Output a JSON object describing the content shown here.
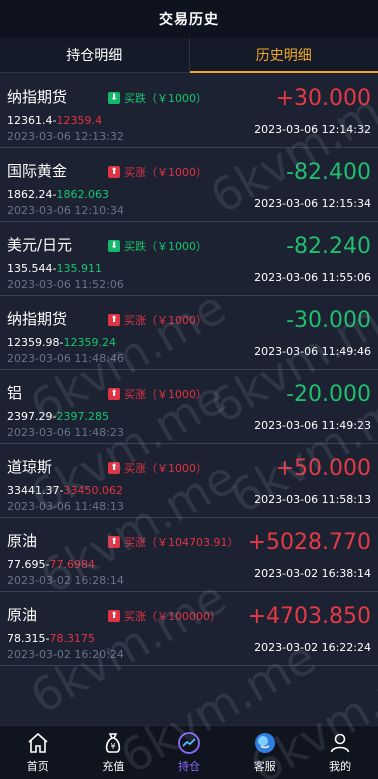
{
  "header": {
    "title": "交易历史"
  },
  "tabs": [
    {
      "label": "持仓明细",
      "active": false
    },
    {
      "label": "历史明细",
      "active": true
    }
  ],
  "records": [
    {
      "name": "纳指期货",
      "direction": "down",
      "direction_text": "买跌（￥1000）",
      "open_price": "12361.4",
      "close_price": "12359.4",
      "close_dir": "up",
      "open_time": "2023-03-06 12:13:32",
      "pnl": "+30.000",
      "pnl_sign": "pos",
      "close_time": "2023-03-06 12:14:32"
    },
    {
      "name": "国际黄金",
      "direction": "up",
      "direction_text": "买涨（￥1000）",
      "open_price": "1862.24",
      "close_price": "1862.063",
      "close_dir": "down",
      "open_time": "2023-03-06 12:10:34",
      "pnl": "-82.400",
      "pnl_sign": "neg",
      "close_time": "2023-03-06 12:15:34"
    },
    {
      "name": "美元/日元",
      "direction": "down",
      "direction_text": "买跌（￥1000）",
      "open_price": "135.544",
      "close_price": "135.911",
      "close_dir": "down",
      "open_time": "2023-03-06 11:52:06",
      "pnl": "-82.240",
      "pnl_sign": "neg",
      "close_time": "2023-03-06 11:55:06"
    },
    {
      "name": "纳指期货",
      "direction": "up",
      "direction_text": "买涨（￥1000）",
      "open_price": "12359.98",
      "close_price": "12359.24",
      "close_dir": "down",
      "open_time": "2023-03-06 11:48:46",
      "pnl": "-30.000",
      "pnl_sign": "neg",
      "close_time": "2023-03-06 11:49:46"
    },
    {
      "name": "铝",
      "direction": "up",
      "direction_text": "买涨（￥1000）",
      "open_price": "2397.29",
      "close_price": "2397.285",
      "close_dir": "down",
      "open_time": "2023-03-06 11:48:23",
      "pnl": "-20.000",
      "pnl_sign": "neg",
      "close_time": "2023-03-06 11:49:23"
    },
    {
      "name": "道琼斯",
      "direction": "up",
      "direction_text": "买涨（￥1000）",
      "open_price": "33441.37",
      "close_price": "33450.062",
      "close_dir": "up",
      "open_time": "2023-03-06 11:48:13",
      "pnl": "+50.000",
      "pnl_sign": "pos",
      "close_time": "2023-03-06 11:58:13"
    },
    {
      "name": "原油",
      "direction": "up",
      "direction_text": "买涨（￥104703.91）",
      "open_price": "77.695",
      "close_price": "77.6984",
      "close_dir": "up",
      "open_time": "2023-03-02 16:28:14",
      "pnl": "+5028.770",
      "pnl_sign": "pos",
      "close_time": "2023-03-02 16:38:14"
    },
    {
      "name": "原油",
      "direction": "up",
      "direction_text": "买涨（￥100000）",
      "open_price": "78.315",
      "close_price": "78.3175",
      "close_dir": "up",
      "open_time": "2023-03-02 16:20:24",
      "pnl": "+4703.850",
      "pnl_sign": "pos",
      "close_time": "2023-03-02 16:22:24"
    }
  ],
  "watermark": "6kvm.me",
  "nav": [
    {
      "label": "首页",
      "icon": "home-icon"
    },
    {
      "label": "充值",
      "icon": "money-bag-icon"
    },
    {
      "label": "持仓",
      "icon": "chart-icon",
      "active": true
    },
    {
      "label": "客服",
      "icon": "support-icon"
    },
    {
      "label": "我的",
      "icon": "user-icon"
    }
  ],
  "colors": {
    "up": "#e03344",
    "down": "#17c46f",
    "accent": "#f0a82c",
    "nav_active": "#8c6cff"
  }
}
